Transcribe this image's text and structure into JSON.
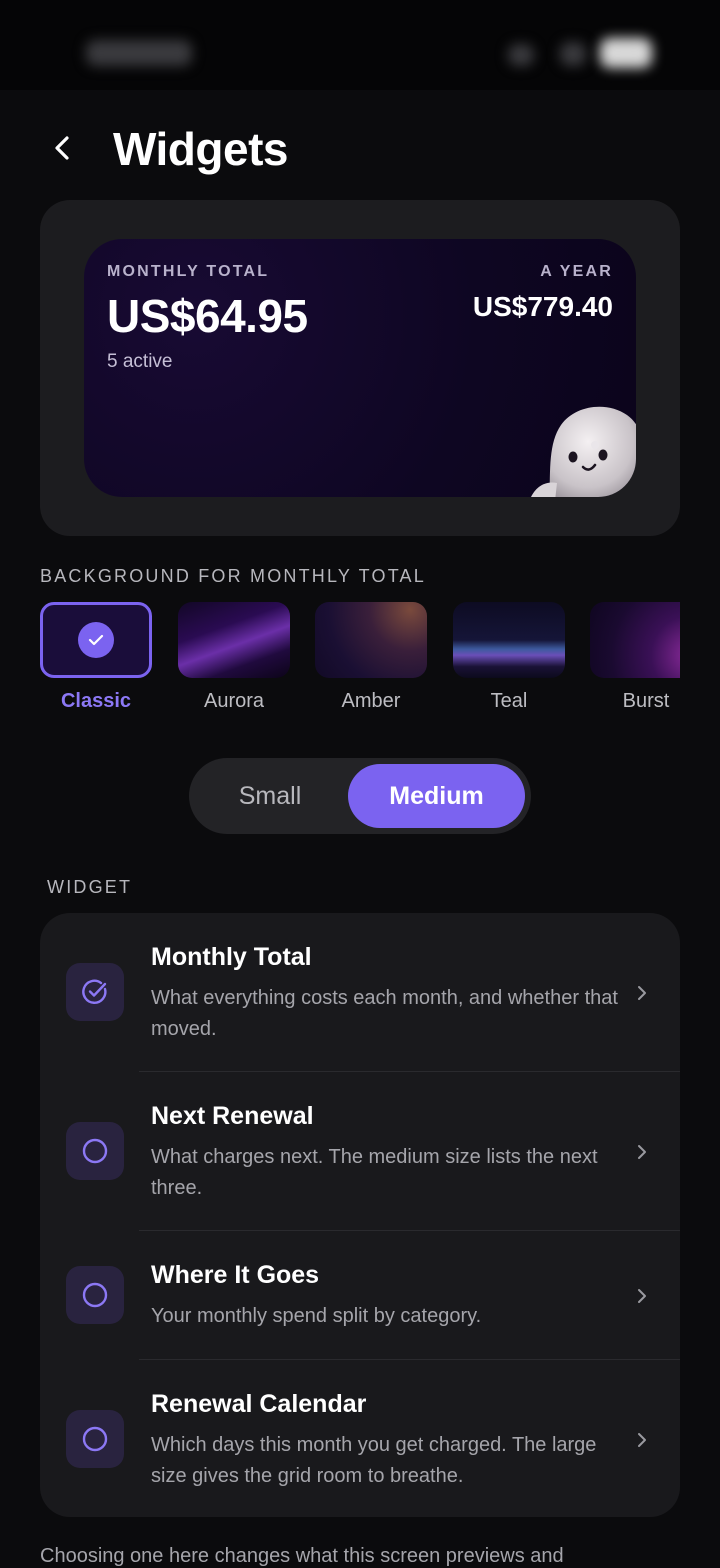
{
  "header": {
    "title": "Widgets"
  },
  "widget_preview": {
    "monthly_label": "MONTHLY TOTAL",
    "monthly_amount": "US$64.95",
    "active_count": "5 active",
    "year_label": "A YEAR",
    "year_amount": "US$779.40"
  },
  "backgrounds": {
    "section_label": "BACKGROUND FOR MONTHLY TOTAL",
    "options": [
      {
        "name": "Classic",
        "selected": true
      },
      {
        "name": "Aurora",
        "selected": false
      },
      {
        "name": "Amber",
        "selected": false
      },
      {
        "name": "Teal",
        "selected": false
      },
      {
        "name": "Burst",
        "selected": false
      }
    ]
  },
  "size_toggle": {
    "small_label": "Small",
    "medium_label": "Medium",
    "selected": "Medium"
  },
  "widgets": {
    "section_label": "WIDGET",
    "items": [
      {
        "title": "Monthly Total",
        "description": "What everything costs each month, and whether that moved.",
        "selected": true,
        "icon": "check-circle-icon"
      },
      {
        "title": "Next Renewal",
        "description": "What charges next. The medium size lists the next three.",
        "selected": false,
        "icon": "circle-icon"
      },
      {
        "title": "Where It Goes",
        "description": "Your monthly spend split by category.",
        "selected": false,
        "icon": "circle-icon"
      },
      {
        "title": "Renewal Calendar",
        "description": "Which days this month you get charged. The large size gives the grid room to breathe.",
        "selected": false,
        "icon": "circle-icon"
      }
    ]
  },
  "footer": {
    "text": "Choosing one here changes what this screen previews and"
  },
  "colors": {
    "accent": "#7b63f0",
    "background": "#0b0b0d",
    "card": "#19191c"
  }
}
